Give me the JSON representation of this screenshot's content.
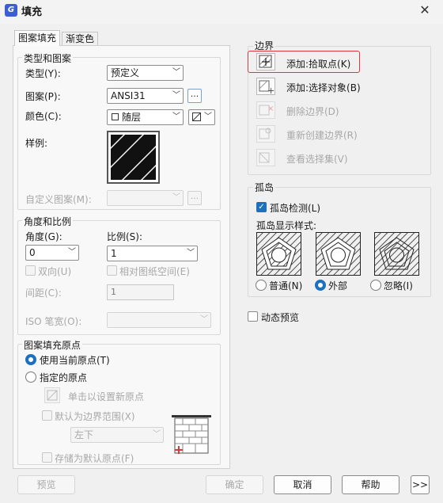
{
  "window": {
    "title": "填充",
    "app_icon": "gstarcad-logo",
    "close_glyph": "✕"
  },
  "tabs": [
    "图案填充",
    "渐变色"
  ],
  "type_pattern": {
    "title": "类型和图案",
    "type_label": "类型(Y):",
    "type_value": "预定义",
    "pattern_label": "图案(P):",
    "pattern_value": "ANSI31",
    "browse_label": "...",
    "color_label": "颜色(C):",
    "color_value": "随层",
    "swatch_label": "样例:",
    "custom_label": "自定义图案(M):",
    "custom_browse": "..."
  },
  "angle_scale": {
    "title": "角度和比例",
    "angle_label": "角度(G):",
    "angle_value": "0",
    "scale_label": "比例(S):",
    "scale_value": "1",
    "double_label": "双向(U)",
    "paper_label": "相对图纸空间(E)",
    "spacing_label": "间距(C):",
    "spacing_value": "1",
    "iso_label": "ISO 笔宽(O):"
  },
  "origin": {
    "title": "图案填充原点",
    "use_current_label": "使用当前原点(T)",
    "specified_label": "指定的原点",
    "click_set_label": "单击以设置新原点",
    "default_extent_label": "默认为边界范围(X)",
    "position_value": "左下",
    "store_default_label": "存储为默认原点(F)"
  },
  "boundary": {
    "title": "边界",
    "actions": [
      {
        "label": "添加:拾取点(K)",
        "icon": "pick-point-icon",
        "enabled": true
      },
      {
        "label": "添加:选择对象(B)",
        "icon": "select-objects-icon",
        "enabled": true
      },
      {
        "label": "删除边界(D)",
        "icon": "remove-boundary-icon",
        "enabled": false
      },
      {
        "label": "重新创建边界(R)",
        "icon": "recreate-boundary-icon",
        "enabled": false
      },
      {
        "label": "查看选择集(V)",
        "icon": "view-selection-icon",
        "enabled": false
      }
    ]
  },
  "islands": {
    "title": "孤岛",
    "detect_label": "孤岛检测(L)",
    "style_label": "孤岛显示样式:",
    "styles": [
      {
        "label": "普通(N)",
        "selected": false
      },
      {
        "label": "外部",
        "selected": true
      },
      {
        "label": "忽略(I)",
        "selected": false
      }
    ]
  },
  "dynamic_preview_label": "动态预览",
  "footer": {
    "preview": "预览",
    "ok": "确定",
    "cancel": "取消",
    "help": "帮助",
    "more": ">>"
  },
  "colors": {
    "accent": "#1d6fc0",
    "highlight": "#e0353b"
  }
}
